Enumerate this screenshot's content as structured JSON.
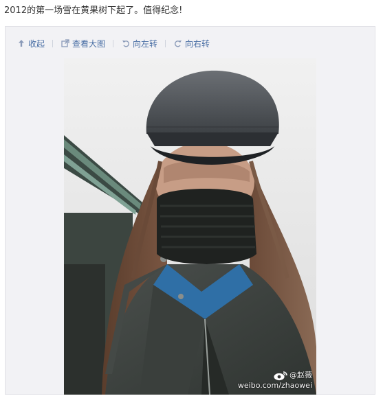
{
  "post": {
    "text": "2012的第一场雪在黄果树下起了。值得纪念!"
  },
  "toolbar": {
    "collapse_label": "收起",
    "view_large_label": "查看大图",
    "rotate_left_label": "向左转",
    "rotate_right_label": "向右转",
    "link_color": "#4a6fa5"
  },
  "photo": {
    "watermark_user": "@赵薇",
    "watermark_url": "weibo.com/zhaowei"
  },
  "icons": {
    "collapse": "arrow-up-icon",
    "view_large": "external-link-icon",
    "rotate_left": "rotate-left-icon",
    "rotate_right": "rotate-right-icon",
    "weibo_logo": "weibo-logo-icon"
  }
}
